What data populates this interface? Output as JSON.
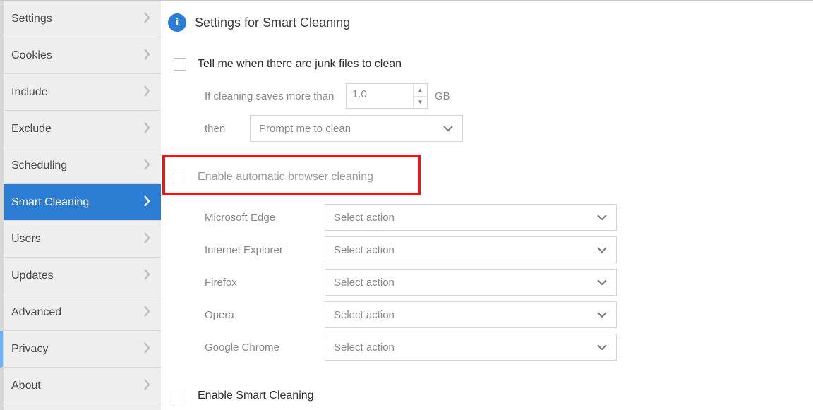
{
  "sidebar": {
    "items": [
      {
        "label": "Settings"
      },
      {
        "label": "Cookies"
      },
      {
        "label": "Include"
      },
      {
        "label": "Exclude"
      },
      {
        "label": "Scheduling"
      },
      {
        "label": "Smart Cleaning"
      },
      {
        "label": "Users"
      },
      {
        "label": "Updates"
      },
      {
        "label": "Advanced"
      },
      {
        "label": "Privacy"
      },
      {
        "label": "About"
      }
    ],
    "active_index": 5
  },
  "header": {
    "title": "Settings for Smart Cleaning"
  },
  "junk": {
    "checkbox_label": "Tell me when there are junk files to clean",
    "threshold_label": "If cleaning saves more than",
    "threshold_value": "1.0",
    "threshold_unit": "GB",
    "then_label": "then",
    "then_action": "Prompt me to clean"
  },
  "browser": {
    "checkbox_label": "Enable automatic browser cleaning",
    "default_action": "Select action",
    "items": [
      {
        "name": "Microsoft Edge",
        "action": "Select action"
      },
      {
        "name": "Internet Explorer",
        "action": "Select action"
      },
      {
        "name": "Firefox",
        "action": "Select action"
      },
      {
        "name": "Opera",
        "action": "Select action"
      },
      {
        "name": "Google Chrome",
        "action": "Select action"
      }
    ]
  },
  "smart": {
    "checkbox_label": "Enable Smart Cleaning"
  }
}
